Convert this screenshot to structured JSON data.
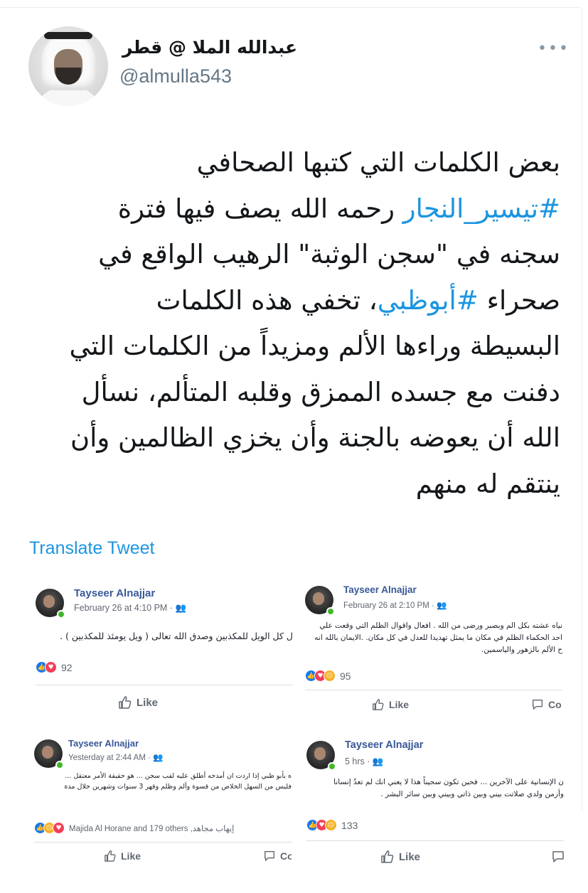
{
  "tweet": {
    "display_name": "عبدالله الملا @ قطر",
    "handle": "@almulla543",
    "more_icon": "more-dots-icon",
    "text": {
      "lines": [
        {
          "before": "بعض الكلمات التي كتبها الصحافي",
          "hashtag": "",
          "after": ""
        },
        {
          "before": "",
          "hashtag": "#تيسير_النجار",
          "after": " رحمه الله يصف فيها فترة"
        },
        {
          "before": "سجنه في \"سجن الوثبة\" الرهيب الواقع في",
          "hashtag": "",
          "after": ""
        },
        {
          "before": "صحراء ",
          "hashtag": "#أبوظبي",
          "after": "، تخفي هذه الكلمات"
        },
        {
          "before": "البسيطة وراءها الألم ومزيداً من الكلمات التي",
          "hashtag": "",
          "after": ""
        },
        {
          "before": "دفنت مع جسده الممزق وقلبه المتألم، نسأل",
          "hashtag": "",
          "after": ""
        },
        {
          "before": "الله أن يعوضه بالجنة وأن يخزي الظالمين وأن",
          "hashtag": "",
          "after": ""
        },
        {
          "before": "ينتقم له منهم",
          "hashtag": "",
          "after": ""
        }
      ]
    },
    "translate_label": "Translate Tweet"
  },
  "posts": [
    {
      "author": "Tayseer Alnajjar",
      "time": "February 26 at 4:10 PM · ",
      "text_lines": [
        "ل كل الويل للمكذبين وصدق الله تعالى ( ويل يومئذ للمكذبين ) ."
      ],
      "reactions": [
        "like",
        "love"
      ],
      "count": "92",
      "like_label": "Like",
      "comment_label": ""
    },
    {
      "author": "Tayseer Alnajjar",
      "time": "February 26 at 2:10 PM · ",
      "text_lines": [
        "نياه عشته بكل الم وبصبر ورضى من الله . افعال واقوال الظلم التي وقعت علي",
        "احد الحكماء الظلم في مكان ما يمثل تهديدا للعدل في كل مكان. .الايمان بالله انه",
        "ح الألم بالزهور والياسمين."
      ],
      "reactions": [
        "like",
        "love",
        "sad"
      ],
      "count": "95",
      "like_label": "Like",
      "comment_label": "Co"
    },
    {
      "author": "Tayseer Alnajjar",
      "time": "Yesterday at 2:44 AM · ",
      "text_lines": [
        "ه بأبو ظبي إذا اردت ان أمدحه أطلق عليه لقب سجن ... هو حقيقة الأمر معتقل ...",
        "فليس من السهل الخلاص من قسوة وألم وظلم وقهر 3 سنوات وشهرين خلال مدة"
      ],
      "reactions": [
        "like",
        "sad",
        "love"
      ],
      "count": "Majida Al Horane and 179 others ,إيهاب مجاهد",
      "like_label": "Like",
      "comment_label": "Co"
    },
    {
      "author": "Tayseer Alnajjar",
      "time": "5 hrs · ",
      "text_lines": [
        "ن الإنسانية على الآخرين ... فحين تكون سجيناً هذا لا يعني انك لم تعدُ إنسانا",
        "وأزمن ولدي صلاتت بيني وبين ذاتي وبيني وبين سائر البشر ."
      ],
      "reactions": [
        "like",
        "love",
        "sad"
      ],
      "count": "133",
      "like_label": "Like",
      "comment_label": ""
    }
  ]
}
